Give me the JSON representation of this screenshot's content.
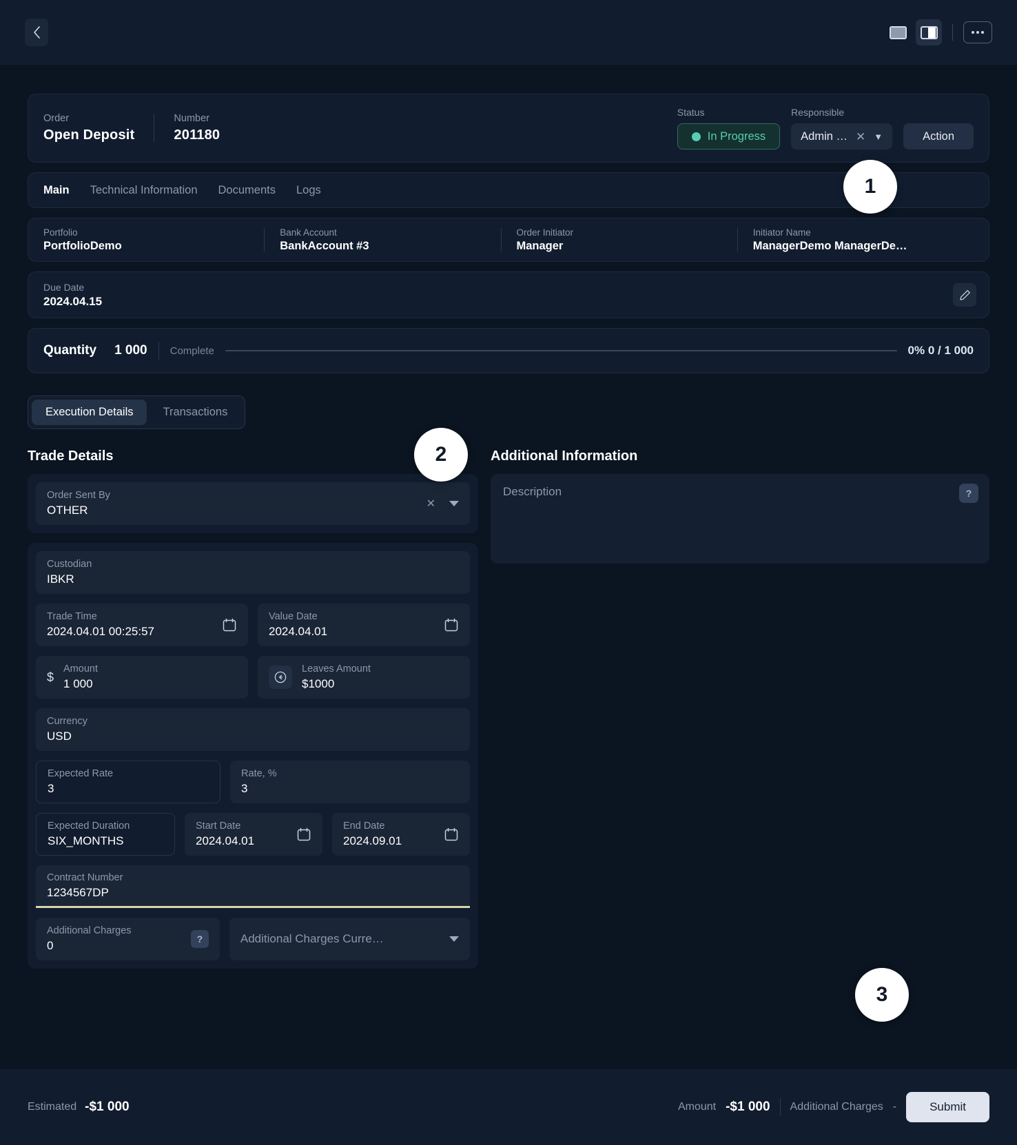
{
  "topbar": {
    "back_icon": "chevron-left-icon",
    "view_full_icon": "layout-full-icon",
    "view_split_icon": "layout-split-icon",
    "more_icon": "more-horizontal-icon"
  },
  "header": {
    "order_label": "Order",
    "order_value": "Open Deposit",
    "number_label": "Number",
    "number_value": "201180",
    "status_label": "Status",
    "status_value": "In Progress",
    "status_color": "#57cdb4",
    "responsible_label": "Responsible",
    "responsible_value": "Admin …",
    "action_label": "Action"
  },
  "tabs": [
    {
      "label": "Main",
      "active": true
    },
    {
      "label": "Technical Information",
      "active": false
    },
    {
      "label": "Documents",
      "active": false
    },
    {
      "label": "Logs",
      "active": false
    }
  ],
  "info": [
    {
      "label": "Portfolio",
      "value": "PortfolioDemo"
    },
    {
      "label": "Bank Account",
      "value": "BankAccount #3"
    },
    {
      "label": "Order Initiator",
      "value": "Manager"
    },
    {
      "label": "Initiator Name",
      "value": "ManagerDemo ManagerDe…"
    }
  ],
  "due": {
    "label": "Due Date",
    "value": "2024.04.15",
    "edit_icon": "pencil-icon"
  },
  "quantity": {
    "title": "Quantity",
    "value": "1 000",
    "complete_label": "Complete",
    "progress_percent": 0,
    "stat": "0% 0 / 1 000"
  },
  "segmented": [
    {
      "label": "Execution Details",
      "active": true
    },
    {
      "label": "Transactions",
      "active": false
    }
  ],
  "trade_details": {
    "title": "Trade Details",
    "order_sent_by": {
      "label": "Order Sent By",
      "value": "OTHER"
    },
    "custodian": {
      "label": "Custodian",
      "value": "IBKR"
    },
    "trade_time": {
      "label": "Trade Time",
      "value": "2024.04.01 00:25:57"
    },
    "value_date": {
      "label": "Value Date",
      "value": "2024.04.01"
    },
    "amount": {
      "label": "Amount",
      "value": "1 000",
      "prefix": "$"
    },
    "leaves_amount": {
      "label": "Leaves Amount",
      "value": "$1000"
    },
    "currency": {
      "label": "Currency",
      "value": "USD"
    },
    "expected_rate": {
      "label": "Expected Rate",
      "value": "3"
    },
    "rate_pct": {
      "label": "Rate, %",
      "value": "3"
    },
    "expected_duration": {
      "label": "Expected Duration",
      "value": "SIX_MONTHS"
    },
    "start_date": {
      "label": "Start Date",
      "value": "2024.04.01"
    },
    "end_date": {
      "label": "End Date",
      "value": "2024.09.01"
    },
    "contract_number": {
      "label": "Contract Number",
      "value": "1234567DP",
      "focus_color": "#d7d6ae"
    },
    "additional_charges": {
      "label": "Additional Charges",
      "value": "0"
    },
    "additional_charges_currency": {
      "placeholder": "Additional Charges Curre…"
    }
  },
  "additional_information": {
    "title": "Additional Information",
    "description_placeholder": "Description"
  },
  "footer": {
    "estimated_label": "Estimated",
    "estimated_value": "-$1 000",
    "amount_label": "Amount",
    "amount_value": "-$1 000",
    "charges_label": "Additional Charges",
    "charges_value": "-",
    "submit_label": "Submit"
  },
  "markers": {
    "one": "1",
    "two": "2",
    "three": "3"
  }
}
